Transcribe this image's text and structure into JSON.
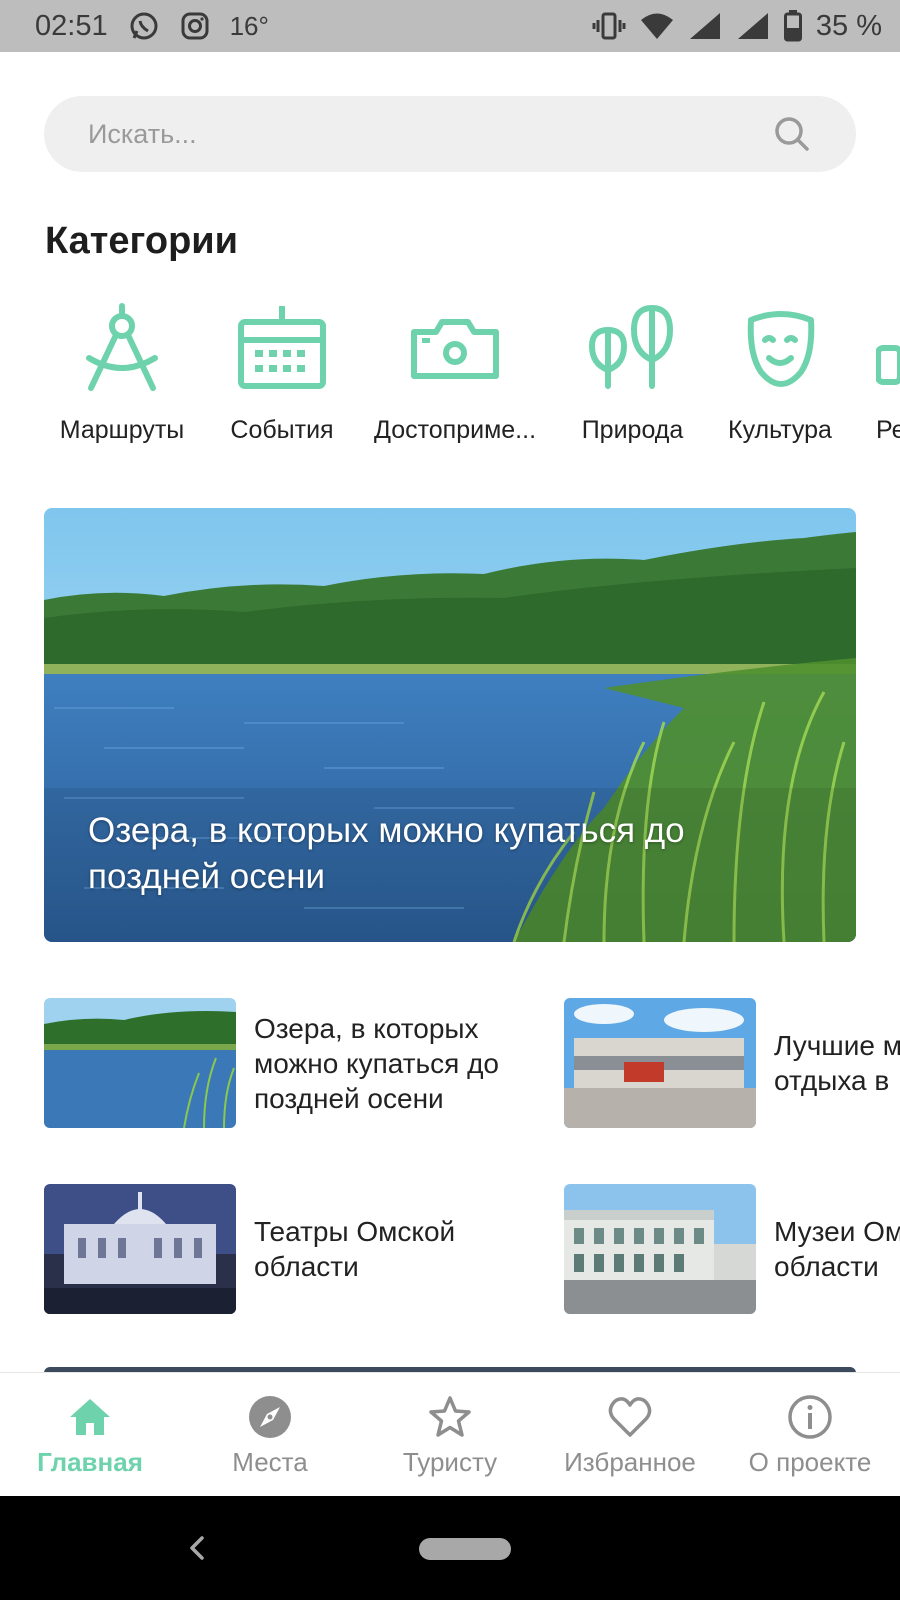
{
  "status_bar": {
    "time": "02:51",
    "temperature": "16°",
    "battery": "35 %"
  },
  "search": {
    "placeholder": "Искать..."
  },
  "categories": {
    "title": "Категории",
    "items": [
      {
        "label": "Маршруты",
        "icon": "compass-drafting-icon"
      },
      {
        "label": "События",
        "icon": "calendar-icon"
      },
      {
        "label": "Достоприме...",
        "icon": "camera-icon"
      },
      {
        "label": "Природа",
        "icon": "trees-icon"
      },
      {
        "label": "Культура",
        "icon": "theater-mask-icon"
      },
      {
        "label": "Ре",
        "icon": "partial-icon"
      }
    ]
  },
  "hero": {
    "title": "Озера, в которых можно купаться до поздней осени"
  },
  "cards": [
    {
      "title": "Озера, в которых можно купаться до поздней осени",
      "image": "lake"
    },
    {
      "title": "Лучшие м\nотдыха в",
      "image": "building"
    },
    {
      "title": "Театры Омской области",
      "image": "theater"
    },
    {
      "title": "Музеи Ом\nобласти",
      "image": "museum"
    }
  ],
  "bottom_nav": [
    {
      "label": "Главная",
      "icon": "home-icon",
      "active": true
    },
    {
      "label": "Места",
      "icon": "compass-icon",
      "active": false
    },
    {
      "label": "Туристу",
      "icon": "star-icon",
      "active": false
    },
    {
      "label": "Избранное",
      "icon": "heart-icon",
      "active": false
    },
    {
      "label": "О проекте",
      "icon": "info-icon",
      "active": false
    }
  ],
  "colors": {
    "accent": "#6ed3ad",
    "status_bar": "#bdbdbd",
    "nav_inactive": "#8e8e8e"
  }
}
